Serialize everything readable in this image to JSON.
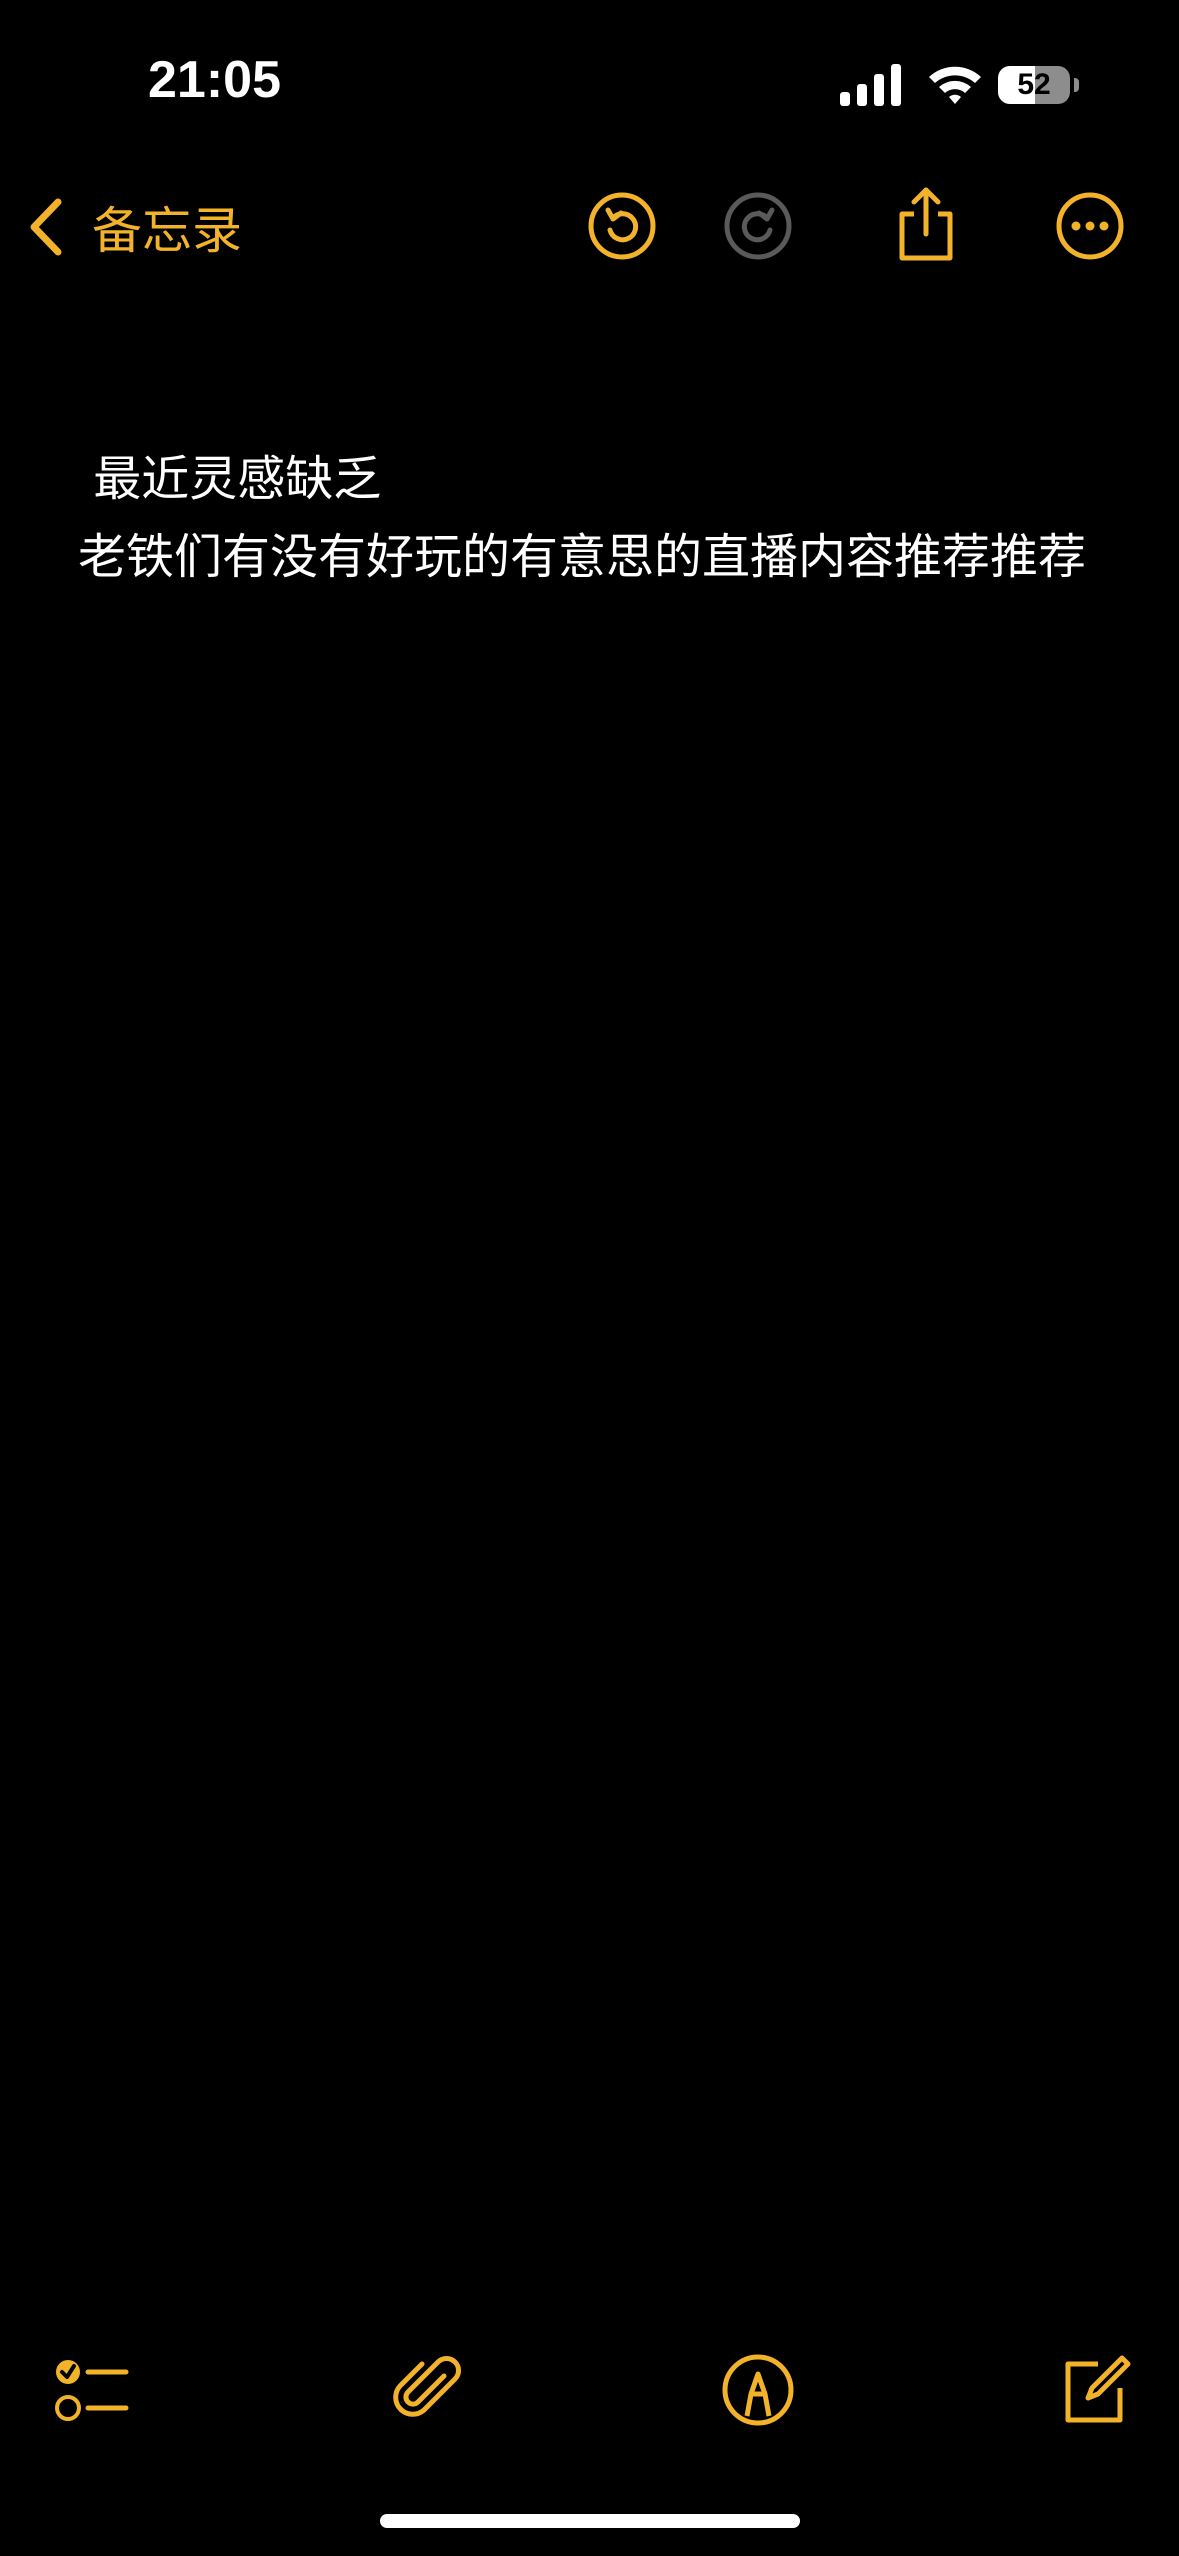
{
  "status_bar": {
    "time": "21:05",
    "battery_level": 52,
    "battery_text": "52",
    "icons": [
      "signal-icon",
      "wifi-icon",
      "battery-icon"
    ]
  },
  "nav": {
    "back_label": "备忘录",
    "icons": [
      "chevron-left-icon",
      "undo-icon",
      "redo-icon",
      "share-icon",
      "more-icon"
    ]
  },
  "note": {
    "line1": " 最近灵感缺乏",
    "line2": "老铁们有没有好玩的有意思的直播内容推荐推荐"
  },
  "toolbar": {
    "icons": [
      "checklist-icon",
      "paperclip-icon",
      "markup-icon",
      "compose-icon"
    ]
  },
  "colors": {
    "background": "#000000",
    "accent": "#f2b32a",
    "disabled": "#5a5a5a",
    "text": "#ffffff"
  }
}
